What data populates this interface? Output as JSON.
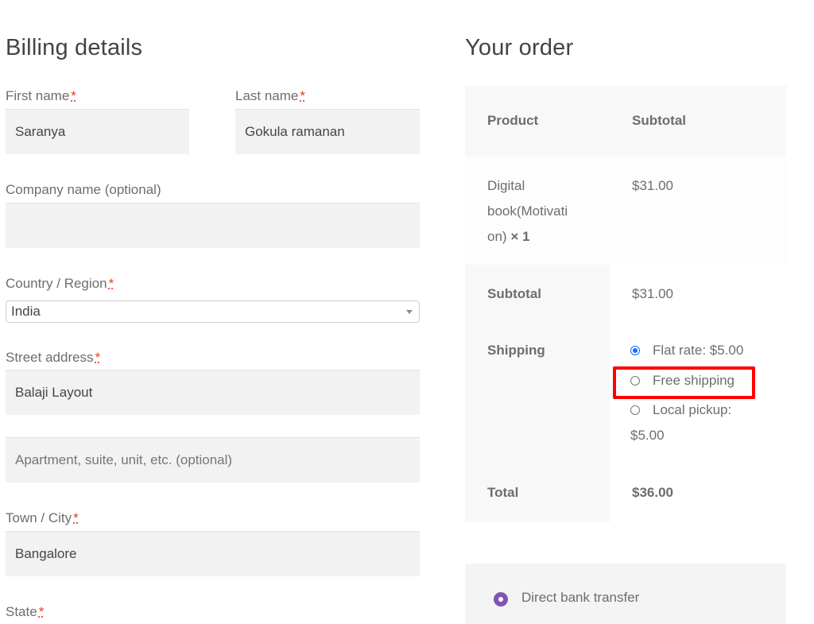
{
  "billing": {
    "title": "Billing details",
    "required_mark": "*",
    "first_name": {
      "label": "First name",
      "value": "Saranya"
    },
    "last_name": {
      "label": "Last name",
      "value": "Gokula ramanan"
    },
    "company": {
      "label": "Company name (optional)",
      "value": ""
    },
    "country": {
      "label": "Country / Region",
      "value": "India"
    },
    "street": {
      "label": "Street address",
      "value": "Balaji Layout"
    },
    "apartment": {
      "placeholder": "Apartment, suite, unit, etc. (optional)",
      "value": ""
    },
    "city": {
      "label": "Town / City",
      "value": "Bangalore"
    },
    "state": {
      "label": "State"
    }
  },
  "order": {
    "title": "Your order",
    "headers": {
      "product": "Product",
      "subtotal": "Subtotal"
    },
    "items": [
      {
        "name_line1": "Digital",
        "name_line2": "book(Motivati",
        "name_line3": "on)",
        "qty": "× 1",
        "subtotal": "$31.00"
      }
    ],
    "subtotal": {
      "label": "Subtotal",
      "value": "$31.00"
    },
    "shipping": {
      "label": "Shipping",
      "options": [
        {
          "label": "Flat rate: $5.00",
          "checked": true
        },
        {
          "label": "Free shipping",
          "checked": false,
          "highlighted": true
        },
        {
          "label": "Local pickup:",
          "label_line2": "$5.00",
          "checked": false
        }
      ]
    },
    "total": {
      "label": "Total",
      "value": "$36.00"
    }
  },
  "payment": {
    "methods": [
      {
        "label": "Direct bank transfer",
        "selected": true
      }
    ]
  },
  "colors": {
    "required": "#e2401c",
    "highlight": "#ff0000",
    "payment_radio": "#7f54b3",
    "shipping_radio": "#0a6cff"
  }
}
